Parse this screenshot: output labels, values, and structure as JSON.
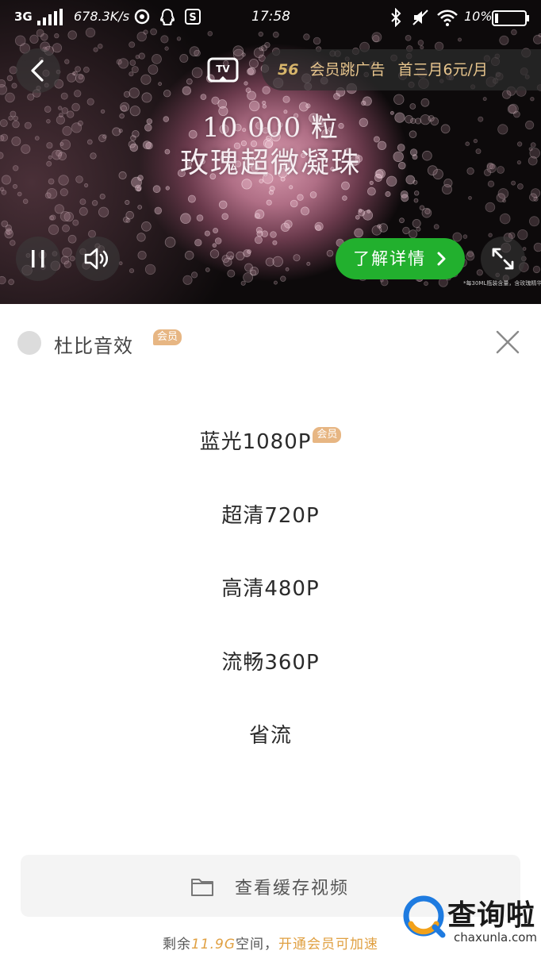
{
  "status_bar": {
    "network": "3G",
    "speed": "678.3K/s",
    "time": "17:58",
    "battery": "10%"
  },
  "video": {
    "ad_countdown": "56",
    "ad_text": "会员跳广告",
    "ad_offer": "首三月6元/月",
    "promo_line1": "10 000 粒",
    "promo_line2": "玫瑰超微凝珠",
    "learn_more_label": "了解详情",
    "disclaimer": "*每30ML瓶装含量，含玫瑰精华"
  },
  "panel": {
    "dolby_label": "杜比音效",
    "vip_badge": "会员",
    "qualities": [
      {
        "label": "蓝光1080P",
        "vip": "会员"
      },
      {
        "label": "超清720P"
      },
      {
        "label": "高清480P"
      },
      {
        "label": "流畅360P"
      },
      {
        "label": "省流"
      }
    ],
    "cache_label": "查看缓存视频",
    "storage_prefix": "剩余",
    "storage_value": "11.9G",
    "storage_suffix": "空间，",
    "storage_link": "开通会员可加速"
  },
  "watermark": {
    "title": "查询啦",
    "sub": "chaxunla.com"
  },
  "colors": {
    "accent_green": "#22b02e",
    "vip_gold": "#e7b683",
    "link_orange": "#e0a042"
  }
}
